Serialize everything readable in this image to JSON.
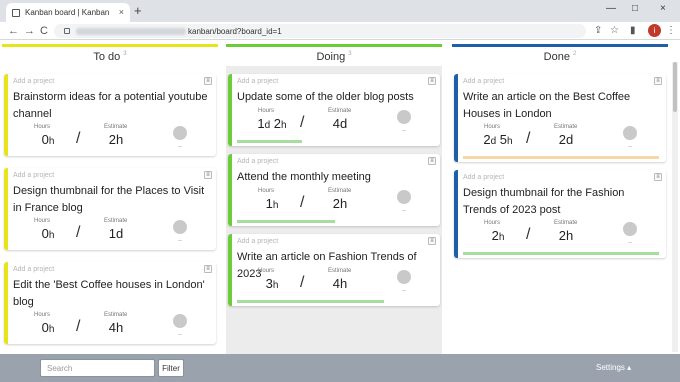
{
  "browser": {
    "tab_title": "Kanban board | Kanban",
    "url_tail": "kanban/board?board_id=1",
    "new_tab": "+",
    "tab_close": "×",
    "window_controls": [
      "—",
      "□",
      "×"
    ],
    "nav": [
      "←",
      "→",
      "C"
    ],
    "profile_initial": "i"
  },
  "colors": {
    "todo": "#e8e41c",
    "doing": "#6ccd3a",
    "done": "#1f5ea8",
    "progress_green": "#a9dca0",
    "progress_orange": "#f6d7a8"
  },
  "columns": [
    {
      "name": "To do",
      "count": "3",
      "cards": [
        {
          "project_placeholder": "Add a project",
          "title": "Brainstorm ideas for a potential youtube channel",
          "hours_label": "Hours",
          "hours": [
            {
              "n": "0",
              "u": "h"
            }
          ],
          "estimate_label": "Estimate",
          "estimate": "2h",
          "assignee": "--",
          "progress": 0,
          "progress_color": ""
        },
        {
          "project_placeholder": "Add a project",
          "title": "Design thumbnail for the Places to Visit in France blog",
          "hours_label": "Hours",
          "hours": [
            {
              "n": "0",
              "u": "h"
            }
          ],
          "estimate_label": "Estimate",
          "estimate": "1d",
          "assignee": "--",
          "progress": 0,
          "progress_color": ""
        },
        {
          "project_placeholder": "Add a project",
          "title": "Edit the 'Best Coffee houses in London' blog",
          "hours_label": "Hours",
          "hours": [
            {
              "n": "0",
              "u": "h"
            }
          ],
          "estimate_label": "Estimate",
          "estimate": "4h",
          "assignee": "--",
          "progress": 0,
          "progress_color": ""
        }
      ]
    },
    {
      "name": "Doing",
      "count": "3",
      "cards": [
        {
          "project_placeholder": "Add a project",
          "title": "Update some of the older blog posts",
          "hours_label": "Hours",
          "hours": [
            {
              "n": "1",
              "u": "d"
            },
            {
              "n": " 2",
              "u": "h"
            }
          ],
          "estimate_label": "Estimate",
          "estimate": "4d",
          "assignee": "--",
          "progress": 0.33,
          "progress_color": "#a9dca0"
        },
        {
          "project_placeholder": "Add a project",
          "title": "Attend the monthly meeting",
          "hours_label": "Hours",
          "hours": [
            {
              "n": "1",
              "u": "h"
            }
          ],
          "estimate_label": "Estimate",
          "estimate": "2h",
          "assignee": "--",
          "progress": 0.5,
          "progress_color": "#a9dca0"
        },
        {
          "project_placeholder": "Add a project",
          "title": "Write an article on Fashion Trends of 2023",
          "hours_label": "Hours",
          "hours": [
            {
              "n": "3",
              "u": "h"
            }
          ],
          "estimate_label": "Estimate",
          "estimate": "4h",
          "assignee": "--",
          "progress": 0.75,
          "progress_color": "#a9dca0"
        }
      ]
    },
    {
      "name": "Done",
      "count": "2",
      "cards": [
        {
          "project_placeholder": "Add a project",
          "title": "Write an article on the Best Coffee Houses in London",
          "hours_label": "Hours",
          "hours": [
            {
              "n": "2",
              "u": "d"
            },
            {
              "n": " 5",
              "u": "h"
            }
          ],
          "estimate_label": "Estimate",
          "estimate": "2d",
          "assignee": "--",
          "progress": 1,
          "progress_color": "#f6d7a8"
        },
        {
          "project_placeholder": "Add a project",
          "title": "Design thumbnail for the Fashion Trends of 2023 post",
          "hours_label": "Hours",
          "hours": [
            {
              "n": "2",
              "u": "h"
            }
          ],
          "estimate_label": "Estimate",
          "estimate": "2h",
          "assignee": "--",
          "progress": 1,
          "progress_color": "#a9dca0"
        }
      ]
    }
  ],
  "footer": {
    "search_placeholder": "Search",
    "filter_label": "Filter",
    "settings_label": "Settings ▴"
  }
}
